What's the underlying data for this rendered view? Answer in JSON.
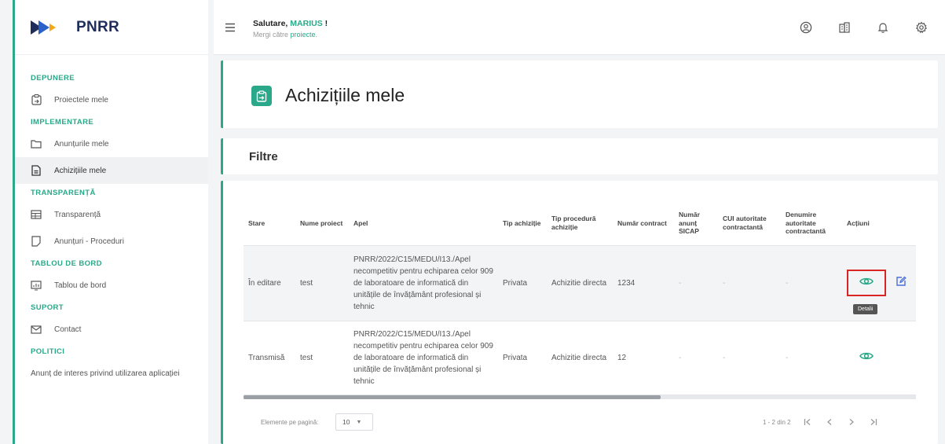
{
  "brand": {
    "name": "PNRR"
  },
  "sidebar": {
    "sections": {
      "depunere": "DEPUNERE",
      "implementare": "IMPLEMENTARE",
      "transparenta": "TRANSPARENȚĂ",
      "tablou": "TABLOU DE BORD",
      "suport": "SUPORT",
      "politici": "POLITICI"
    },
    "items": {
      "proiecte": "Proiectele mele",
      "anunturi": "Anunțurile mele",
      "achizitii": "Achizițiile mele",
      "transparenta": "Transparență",
      "anunturi_proceduri": "Anunțuri - Proceduri",
      "tablou": "Tablou de bord",
      "contact": "Contact",
      "anunt_interes": "Anunț de interes privind utilizarea aplicației"
    }
  },
  "topbar": {
    "greeting": "Salutare, ",
    "user": "MARIUS",
    "greeting_end": " !",
    "goto_prefix": "Mergi către ",
    "goto_link": "proiecte",
    "goto_suffix": "."
  },
  "page": {
    "title": "Achizițiile mele",
    "filters_title": "Filtre"
  },
  "table": {
    "headers": {
      "stare": "Stare",
      "nume": "Nume proiect",
      "apel": "Apel",
      "tip_achizitie": "Tip achiziție",
      "tip_procedura": "Tip procedură achiziție",
      "numar_contract": "Număr contract",
      "numar_anunt": "Număr anunț SICAP",
      "cui": "CUI autoritate contractantă",
      "denumire": "Denumire autoritate contractantă",
      "actiuni": "Acțiuni"
    },
    "rows": [
      {
        "stare": "În editare",
        "nume": "test",
        "apel": "PNRR/2022/C15/MEDU/I13./Apel necompetitiv pentru echiparea celor 909 de laboratoare de informatică din unitățile de învățământ profesional și tehnic",
        "tip_achizitie": "Privata",
        "tip_procedura": "Achizitie directa",
        "numar_contract": "1234",
        "numar_anunt": "-",
        "cui": "-",
        "denumire": "-"
      },
      {
        "stare": "Transmisă",
        "nume": "test",
        "apel": "PNRR/2022/C15/MEDU/I13./Apel necompetitiv pentru echiparea celor 909 de laboratoare de informatică din unitățile de învățământ profesional și tehnic",
        "tip_achizitie": "Privata",
        "tip_procedura": "Achizitie directa",
        "numar_contract": "12",
        "numar_anunt": "-",
        "cui": "-",
        "denumire": "-"
      }
    ],
    "tooltip": "Detalii"
  },
  "pager": {
    "per_page_label": "Elemente pe pagină:",
    "per_page_value": "10",
    "range": "1 - 2 din 2"
  },
  "colors": {
    "accent": "#2aa889",
    "highlight": "#d92424",
    "edit": "#4a6fd6"
  }
}
